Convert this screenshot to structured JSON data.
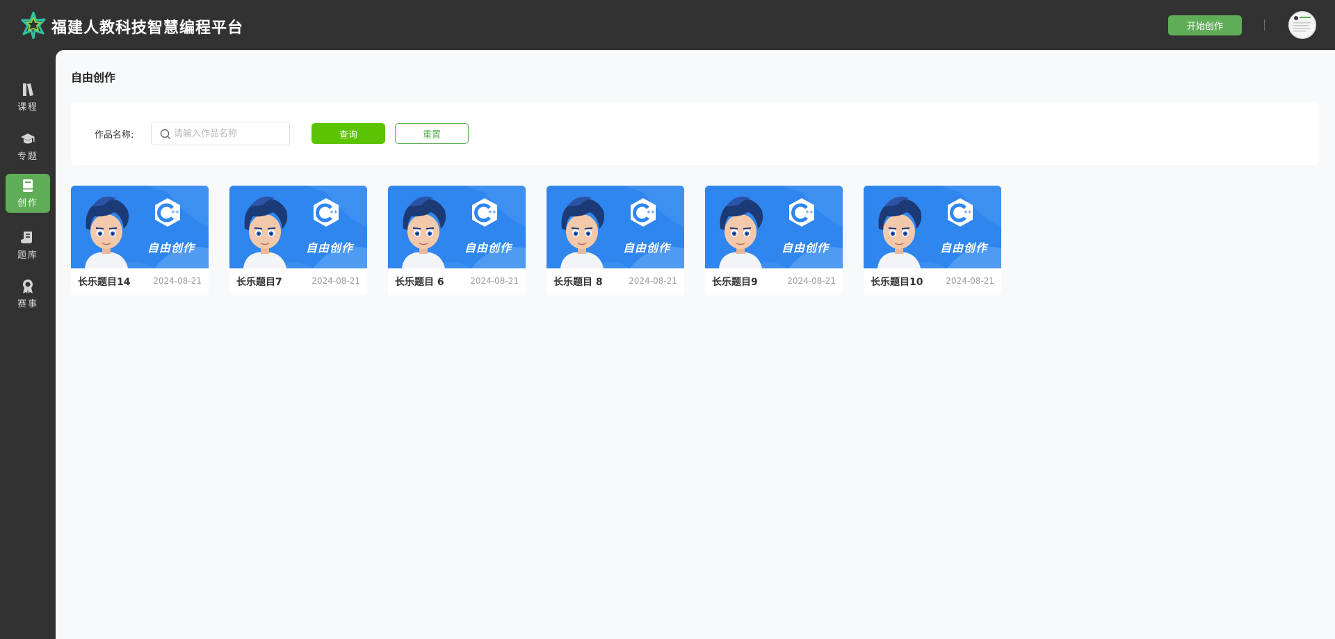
{
  "header": {
    "brand_title": "福建人教科技智慧编程平台",
    "start_button": "开始创作",
    "divider": "|"
  },
  "sidebar": {
    "items": [
      {
        "label": "课程",
        "icon": "book-icon",
        "active": false
      },
      {
        "label": "专题",
        "icon": "graduation-cap-icon",
        "active": false
      },
      {
        "label": "创作",
        "icon": "notebook-icon",
        "active": true
      },
      {
        "label": "题库",
        "icon": "scroll-icon",
        "active": false
      },
      {
        "label": "赛事",
        "icon": "medal-icon",
        "active": false
      }
    ]
  },
  "main": {
    "title": "自由创作",
    "filter": {
      "label": "作品名称:",
      "placeholder": "请输入作品名称",
      "query_button": "查询",
      "reset_button": "重置"
    },
    "cards": [
      {
        "title": "长乐题目14",
        "date": "2024-08-21",
        "thumb_text": "自由创作"
      },
      {
        "title": "长乐题目7",
        "date": "2024-08-21",
        "thumb_text": "自由创作"
      },
      {
        "title": "长乐题目 6",
        "date": "2024-08-21",
        "thumb_text": "自由创作"
      },
      {
        "title": "长乐题目 8",
        "date": "2024-08-21",
        "thumb_text": "自由创作"
      },
      {
        "title": "长乐题目9",
        "date": "2024-08-21",
        "thumb_text": "自由创作"
      },
      {
        "title": "长乐题目10",
        "date": "2024-08-21",
        "thumb_text": "自由创作"
      }
    ]
  },
  "colors": {
    "header_bg": "#323232",
    "accent_green": "#5fad56",
    "query_green": "#5cc302",
    "thumb_blue": "#2f86ee",
    "main_bg": "#f8f9fb"
  }
}
